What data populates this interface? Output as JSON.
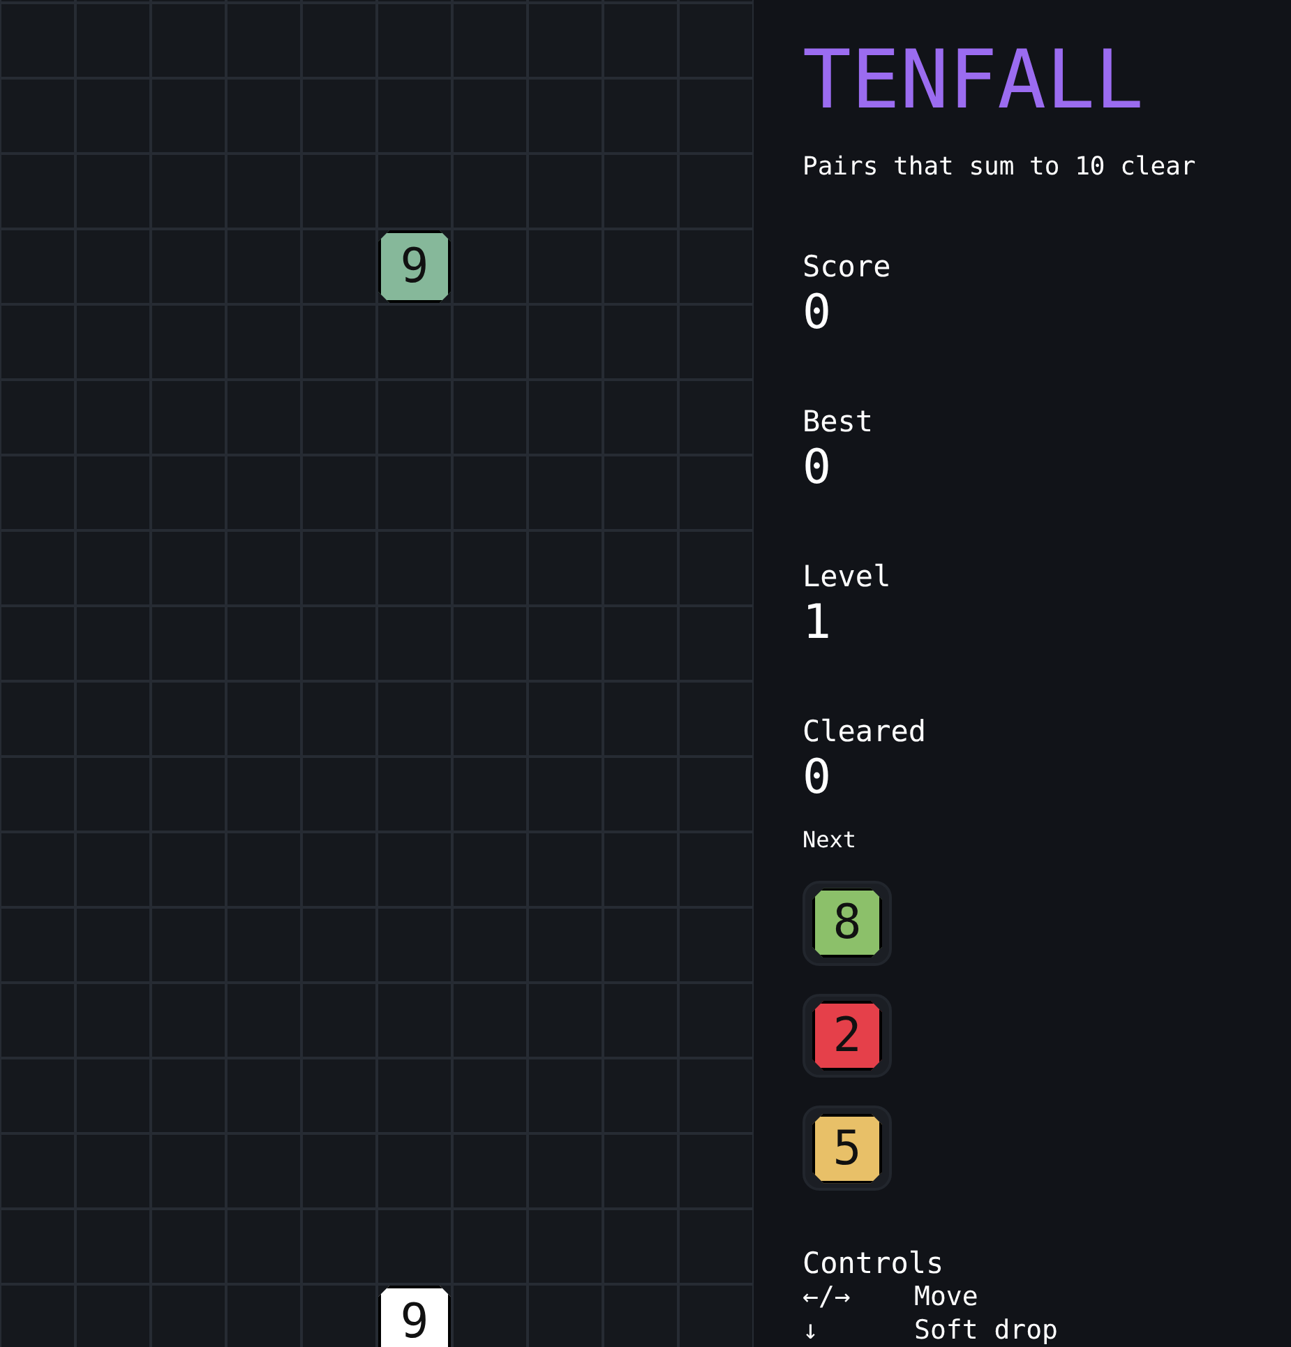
{
  "board": {
    "rows": [
      {
        "cells": [
          {
            "kind": "empty"
          },
          {
            "kind": "empty"
          },
          {
            "kind": "empty"
          },
          {
            "kind": "empty"
          },
          {
            "kind": "empty"
          },
          {
            "kind": "empty"
          },
          {
            "kind": "empty"
          },
          {
            "kind": "empty"
          },
          {
            "kind": "empty"
          },
          {
            "kind": "empty"
          }
        ]
      },
      {
        "cells": [
          {
            "kind": "empty"
          },
          {
            "kind": "empty"
          },
          {
            "kind": "empty"
          },
          {
            "kind": "empty"
          },
          {
            "kind": "empty"
          },
          {
            "kind": "empty"
          },
          {
            "kind": "empty"
          },
          {
            "kind": "empty"
          },
          {
            "kind": "empty"
          },
          {
            "kind": "empty"
          }
        ]
      },
      {
        "cells": [
          {
            "kind": "empty"
          },
          {
            "kind": "empty"
          },
          {
            "kind": "empty"
          },
          {
            "kind": "empty"
          },
          {
            "kind": "empty"
          },
          {
            "kind": "empty"
          },
          {
            "kind": "empty"
          },
          {
            "kind": "empty"
          },
          {
            "kind": "empty"
          },
          {
            "kind": "empty"
          }
        ]
      },
      {
        "cells": [
          {
            "kind": "empty"
          },
          {
            "kind": "empty"
          },
          {
            "kind": "empty"
          },
          {
            "kind": "empty"
          },
          {
            "kind": "empty"
          },
          {
            "kind": "tile",
            "value": "9",
            "color": "#86b89a"
          },
          {
            "kind": "empty"
          },
          {
            "kind": "empty"
          },
          {
            "kind": "empty"
          },
          {
            "kind": "empty"
          }
        ]
      },
      {
        "cells": [
          {
            "kind": "empty"
          },
          {
            "kind": "empty"
          },
          {
            "kind": "empty"
          },
          {
            "kind": "empty"
          },
          {
            "kind": "empty"
          },
          {
            "kind": "empty"
          },
          {
            "kind": "empty"
          },
          {
            "kind": "empty"
          },
          {
            "kind": "empty"
          },
          {
            "kind": "empty"
          }
        ]
      },
      {
        "cells": [
          {
            "kind": "empty"
          },
          {
            "kind": "empty"
          },
          {
            "kind": "empty"
          },
          {
            "kind": "empty"
          },
          {
            "kind": "empty"
          },
          {
            "kind": "empty"
          },
          {
            "kind": "empty"
          },
          {
            "kind": "empty"
          },
          {
            "kind": "empty"
          },
          {
            "kind": "empty"
          }
        ]
      },
      {
        "cells": [
          {
            "kind": "empty"
          },
          {
            "kind": "empty"
          },
          {
            "kind": "empty"
          },
          {
            "kind": "empty"
          },
          {
            "kind": "empty"
          },
          {
            "kind": "empty"
          },
          {
            "kind": "empty"
          },
          {
            "kind": "empty"
          },
          {
            "kind": "empty"
          },
          {
            "kind": "empty"
          }
        ]
      },
      {
        "cells": [
          {
            "kind": "empty"
          },
          {
            "kind": "empty"
          },
          {
            "kind": "empty"
          },
          {
            "kind": "empty"
          },
          {
            "kind": "empty"
          },
          {
            "kind": "empty"
          },
          {
            "kind": "empty"
          },
          {
            "kind": "empty"
          },
          {
            "kind": "empty"
          },
          {
            "kind": "empty"
          }
        ]
      },
      {
        "cells": [
          {
            "kind": "empty"
          },
          {
            "kind": "empty"
          },
          {
            "kind": "empty"
          },
          {
            "kind": "empty"
          },
          {
            "kind": "empty"
          },
          {
            "kind": "empty"
          },
          {
            "kind": "empty"
          },
          {
            "kind": "empty"
          },
          {
            "kind": "empty"
          },
          {
            "kind": "empty"
          }
        ]
      },
      {
        "cells": [
          {
            "kind": "empty"
          },
          {
            "kind": "empty"
          },
          {
            "kind": "empty"
          },
          {
            "kind": "empty"
          },
          {
            "kind": "empty"
          },
          {
            "kind": "empty"
          },
          {
            "kind": "empty"
          },
          {
            "kind": "empty"
          },
          {
            "kind": "empty"
          },
          {
            "kind": "empty"
          }
        ]
      },
      {
        "cells": [
          {
            "kind": "empty"
          },
          {
            "kind": "empty"
          },
          {
            "kind": "empty"
          },
          {
            "kind": "empty"
          },
          {
            "kind": "empty"
          },
          {
            "kind": "empty"
          },
          {
            "kind": "empty"
          },
          {
            "kind": "empty"
          },
          {
            "kind": "empty"
          },
          {
            "kind": "empty"
          }
        ]
      },
      {
        "cells": [
          {
            "kind": "empty"
          },
          {
            "kind": "empty"
          },
          {
            "kind": "empty"
          },
          {
            "kind": "empty"
          },
          {
            "kind": "empty"
          },
          {
            "kind": "empty"
          },
          {
            "kind": "empty"
          },
          {
            "kind": "empty"
          },
          {
            "kind": "empty"
          },
          {
            "kind": "empty"
          }
        ]
      },
      {
        "cells": [
          {
            "kind": "empty"
          },
          {
            "kind": "empty"
          },
          {
            "kind": "empty"
          },
          {
            "kind": "empty"
          },
          {
            "kind": "empty"
          },
          {
            "kind": "empty"
          },
          {
            "kind": "empty"
          },
          {
            "kind": "empty"
          },
          {
            "kind": "empty"
          },
          {
            "kind": "empty"
          }
        ]
      },
      {
        "cells": [
          {
            "kind": "empty"
          },
          {
            "kind": "empty"
          },
          {
            "kind": "empty"
          },
          {
            "kind": "empty"
          },
          {
            "kind": "empty"
          },
          {
            "kind": "empty"
          },
          {
            "kind": "empty"
          },
          {
            "kind": "empty"
          },
          {
            "kind": "empty"
          },
          {
            "kind": "empty"
          }
        ]
      },
      {
        "cells": [
          {
            "kind": "empty"
          },
          {
            "kind": "empty"
          },
          {
            "kind": "empty"
          },
          {
            "kind": "empty"
          },
          {
            "kind": "empty"
          },
          {
            "kind": "empty"
          },
          {
            "kind": "empty"
          },
          {
            "kind": "empty"
          },
          {
            "kind": "empty"
          },
          {
            "kind": "empty"
          }
        ]
      },
      {
        "cells": [
          {
            "kind": "empty"
          },
          {
            "kind": "empty"
          },
          {
            "kind": "empty"
          },
          {
            "kind": "empty"
          },
          {
            "kind": "empty"
          },
          {
            "kind": "empty"
          },
          {
            "kind": "empty"
          },
          {
            "kind": "empty"
          },
          {
            "kind": "empty"
          },
          {
            "kind": "empty"
          }
        ]
      },
      {
        "cells": [
          {
            "kind": "empty"
          },
          {
            "kind": "empty"
          },
          {
            "kind": "empty"
          },
          {
            "kind": "empty"
          },
          {
            "kind": "empty"
          },
          {
            "kind": "empty"
          },
          {
            "kind": "empty"
          },
          {
            "kind": "empty"
          },
          {
            "kind": "empty"
          },
          {
            "kind": "empty"
          }
        ]
      },
      {
        "cells": [
          {
            "kind": "empty"
          },
          {
            "kind": "empty"
          },
          {
            "kind": "empty"
          },
          {
            "kind": "empty"
          },
          {
            "kind": "empty"
          },
          {
            "kind": "tile",
            "value": "9",
            "color": "#ffffff"
          },
          {
            "kind": "empty"
          },
          {
            "kind": "empty"
          },
          {
            "kind": "empty"
          },
          {
            "kind": "empty"
          }
        ]
      }
    ]
  },
  "panel": {
    "title": "TENFALL",
    "subtitle": "Pairs that sum to 10 clear",
    "stats": [
      {
        "label": "Score",
        "value": "0"
      },
      {
        "label": "Best",
        "value": "0"
      },
      {
        "label": "Level",
        "value": "1"
      },
      {
        "label": "Cleared",
        "value": "0"
      }
    ],
    "next": {
      "label": "Next",
      "tiles": [
        {
          "value": "8",
          "color": "#8cc06a"
        },
        {
          "value": "2",
          "color": "#e5404a"
        },
        {
          "value": "5",
          "color": "#e8c068"
        }
      ]
    },
    "controls": {
      "label": "Controls",
      "items": [
        {
          "keys": "←/→",
          "action": "Move"
        },
        {
          "keys": "↓",
          "action": "Soft drop"
        }
      ]
    }
  }
}
